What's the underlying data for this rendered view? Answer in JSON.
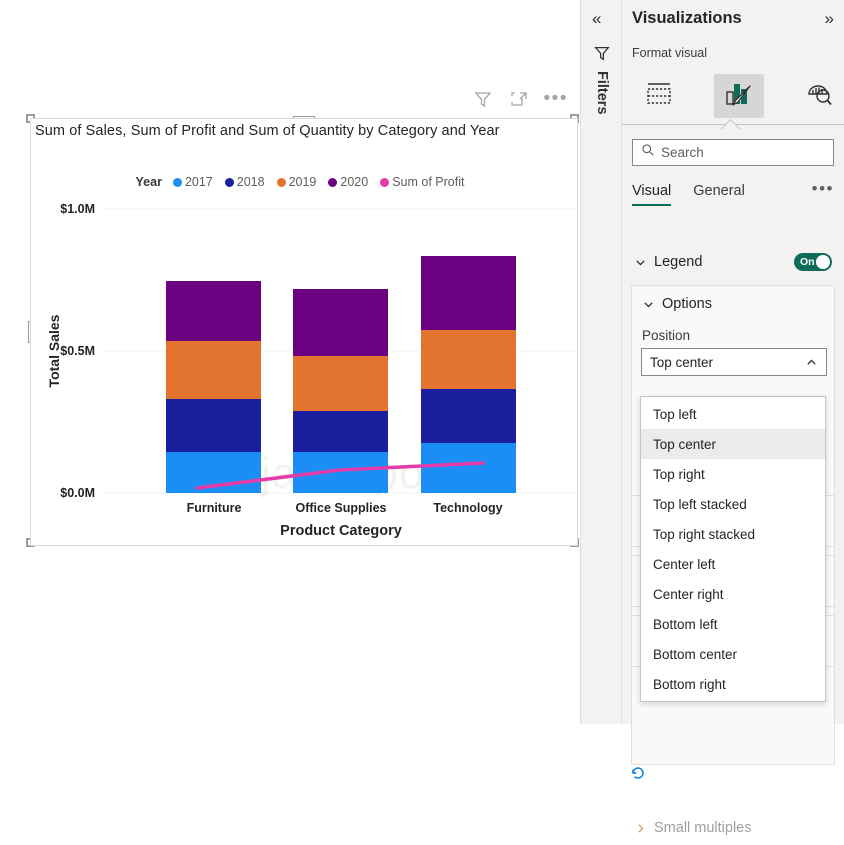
{
  "canvas": {
    "visual_toolbar": {
      "filter_icon": "filter-funnel-icon",
      "focus_icon": "focus-mode-icon",
      "more_label": "•••"
    },
    "watermark": "javaTpoint"
  },
  "chart_data": {
    "type": "bar",
    "stacked": true,
    "title": "Sum of Sales, Sum of Profit and Sum of Quantity by Category and Year",
    "xlabel": "Product Category",
    "ylabel": "Total Sales",
    "legend_title": "Year",
    "legend_position": "Top center",
    "categories": [
      "Furniture",
      "Office Supplies",
      "Technology"
    ],
    "ylim": [
      0,
      1000000
    ],
    "yticks": [
      0,
      500000,
      1000000
    ],
    "ytick_labels": [
      "$0.0M",
      "$0.5M",
      "$1.0M"
    ],
    "grid": true,
    "series": [
      {
        "name": "2017",
        "color": "#1B8EF5",
        "values": [
          144000,
          144000,
          177000
        ]
      },
      {
        "name": "2018",
        "color": "#1A1F9E",
        "values": [
          187000,
          144000,
          191000
        ]
      },
      {
        "name": "2019",
        "color": "#E3742F",
        "values": [
          204000,
          194000,
          208000
        ]
      },
      {
        "name": "2020",
        "color": "#6B0080",
        "values": [
          211000,
          236000,
          260000
        ]
      }
    ],
    "line_series": {
      "name": "Sum of Profit",
      "color": "#E33CA8",
      "values": [
        18000,
        82000,
        105000
      ]
    },
    "legend_entries": [
      {
        "label": "2017",
        "color": "#1B8EF5"
      },
      {
        "label": "2018",
        "color": "#1A1F9E"
      },
      {
        "label": "2019",
        "color": "#E3742F"
      },
      {
        "label": "2020",
        "color": "#6B0080"
      },
      {
        "label": "Sum of Profit",
        "color": "#E33CA8"
      }
    ]
  },
  "filters_rail": {
    "collapse_label": "«",
    "funnel_icon": "filter-funnel-icon",
    "label": "Filters"
  },
  "viz_pane": {
    "title": "Visualizations",
    "expand_label": "»",
    "format_label": "Format visual",
    "tabs": [
      {
        "name": "build-visual",
        "icon": "fields-table-icon",
        "selected": false
      },
      {
        "name": "format-visual",
        "icon": "bar-chart-brush-icon",
        "selected": true
      },
      {
        "name": "analytics",
        "icon": "analytics-magnifier-icon",
        "selected": false
      }
    ],
    "search": {
      "placeholder": "Search",
      "value": "",
      "icon": "search-icon"
    },
    "sub_tabs": [
      {
        "label": "Visual",
        "active": true
      },
      {
        "label": "General",
        "active": false
      }
    ],
    "sub_tabs_more": "•••",
    "legend_section": {
      "label": "Legend",
      "expanded": true,
      "toggle_state": "On",
      "toggle_color": "#0f6c5c"
    },
    "options_card": {
      "title": "Options",
      "expanded": true,
      "position_field": {
        "label": "Position",
        "value": "Top center",
        "open": true,
        "options": [
          "Top left",
          "Top center",
          "Top right",
          "Top left stacked",
          "Top right stacked",
          "Center left",
          "Center right",
          "Bottom left",
          "Bottom center",
          "Bottom right"
        ],
        "selected_option": "Top center"
      }
    },
    "reset_icon": "reset-to-default-icon",
    "small_multiples_section": {
      "label": "Small multiples",
      "expanded": false,
      "disabled": true
    }
  }
}
